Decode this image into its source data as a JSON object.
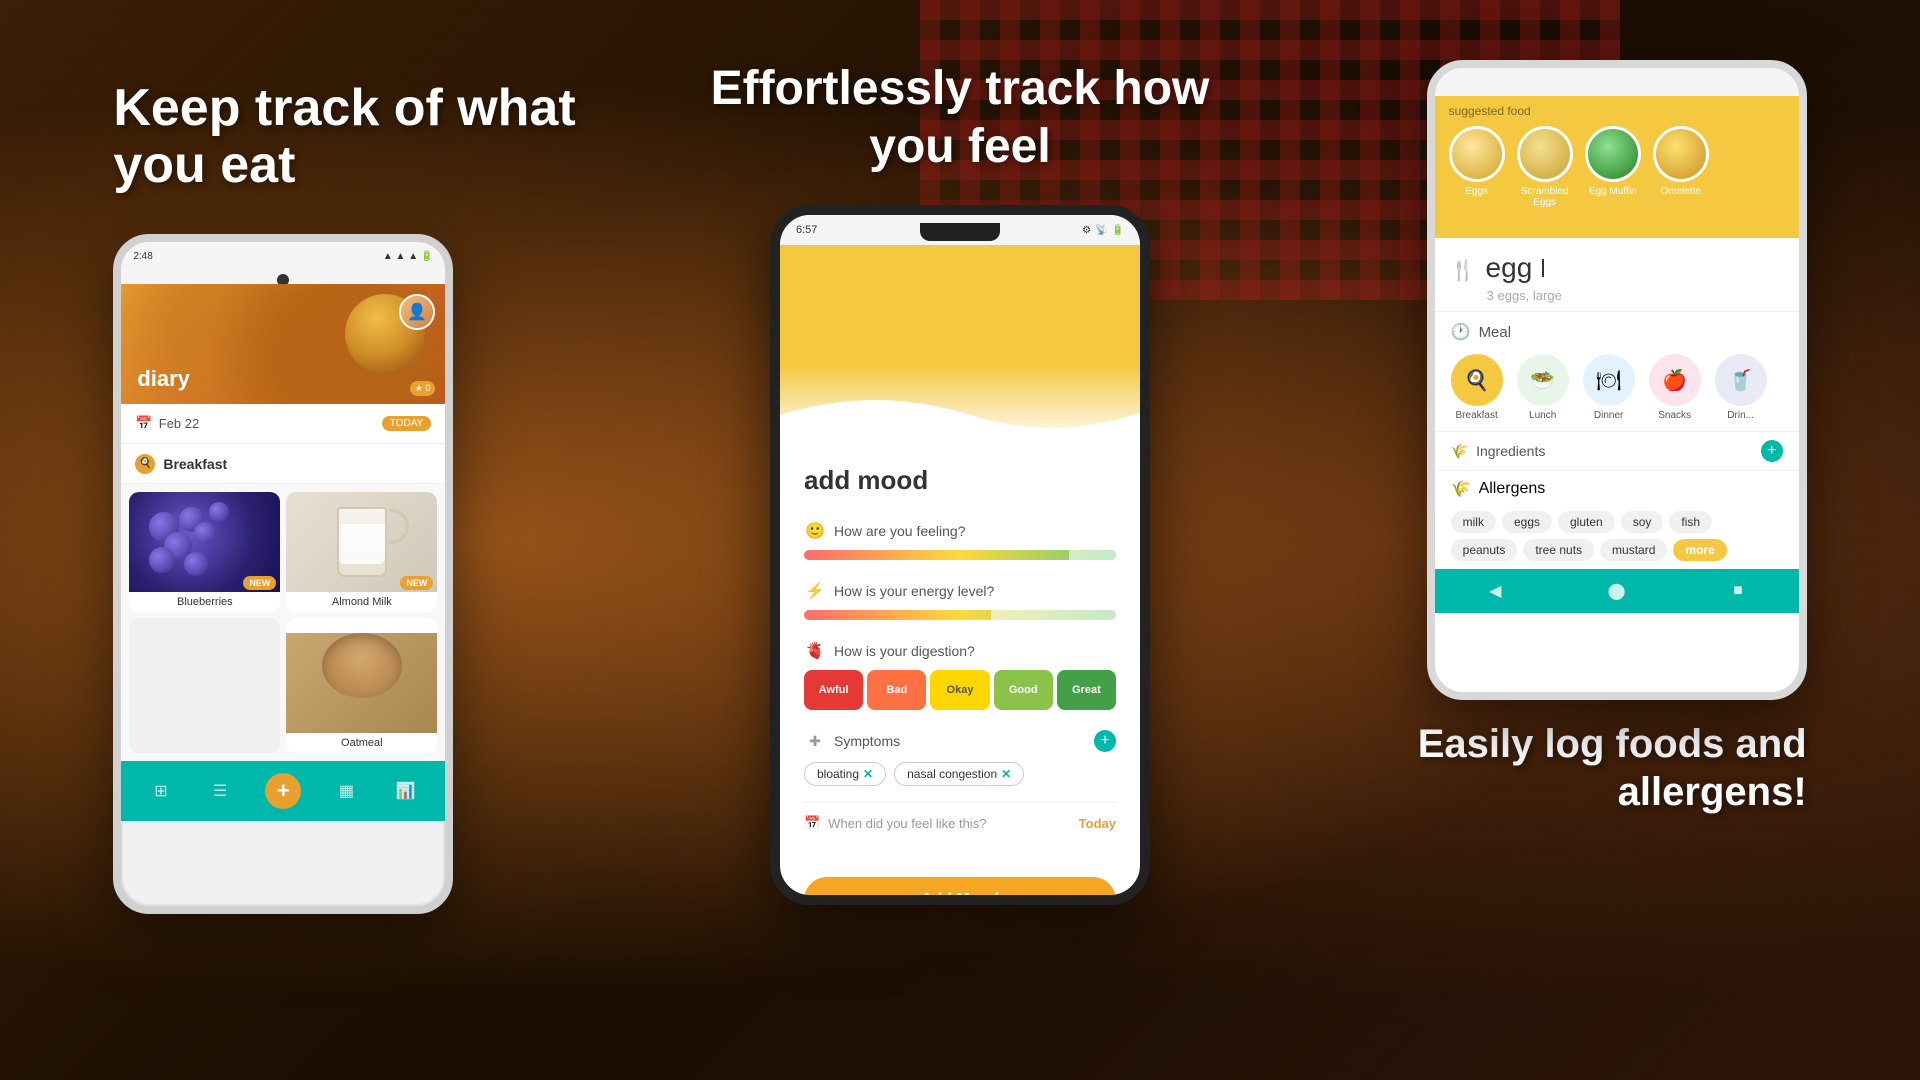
{
  "background": {
    "color": "#2a1a0a"
  },
  "left_panel": {
    "headline": "Keep track of what you eat",
    "phone": {
      "status_bar": {
        "time": "2:48",
        "icons": "📶🔋"
      },
      "diary": {
        "title": "diary",
        "date": "Feb 22",
        "today_label": "TODAY",
        "section": "Breakfast",
        "star_badge": "★ 0"
      },
      "food_items": [
        {
          "name": "Blueberries",
          "badge": "NEW",
          "type": "blueberries"
        },
        {
          "name": "Almond Milk",
          "badge": "NEW",
          "type": "almond_milk"
        },
        {
          "name": "",
          "badge": "",
          "type": "empty"
        },
        {
          "name": "Oatmeal",
          "badge": "",
          "type": "oatmeal"
        }
      ],
      "nav_icons": [
        "grid",
        "bookmark",
        "+",
        "calendar",
        "chart"
      ]
    }
  },
  "center_panel": {
    "headline": "Effortlessly track how you feel",
    "phone": {
      "status_bar": {
        "time": "6:57",
        "icons": "⚙️📶🔋"
      },
      "mood": {
        "title": "add mood",
        "feeling": {
          "question": "How are you feeling?",
          "fill_percent": 85
        },
        "energy": {
          "question": "How is your energy level?",
          "fill_percent": 60
        },
        "digestion": {
          "question": "How is your digestion?",
          "options": [
            "Awful",
            "Bad",
            "Okay",
            "Good",
            "Great"
          ],
          "selected": "Great"
        },
        "symptoms": {
          "title": "Symptoms",
          "tags": [
            "bloating",
            "nasal congestion"
          ]
        },
        "when": {
          "label": "When did you feel like this?",
          "value": "Today"
        },
        "button": "Add Mood"
      }
    }
  },
  "right_panel": {
    "phone": {
      "suggested": {
        "label": "suggested food",
        "foods": [
          {
            "name": "Eggs",
            "type": "eggs"
          },
          {
            "name": "Scrambled\nEggs",
            "type": "scrambled"
          },
          {
            "name": "Egg Muffin",
            "type": "muffin"
          },
          {
            "name": "Omelette",
            "type": "omelette"
          }
        ]
      },
      "search": {
        "food_name": "egg",
        "description": "3 eggs, large"
      },
      "meal": {
        "title": "Meal",
        "options": [
          "Breakfast",
          "Lunch",
          "Dinner",
          "Snacks",
          "Drink"
        ],
        "selected": "Breakfast"
      },
      "ingredients": {
        "title": "Ingredients"
      },
      "allergens": {
        "title": "Allergens",
        "tags": [
          "milk",
          "eggs",
          "gluten",
          "soy",
          "fish",
          "peanuts",
          "tree nuts",
          "mustard"
        ],
        "more": "more"
      }
    },
    "headline": "Easily log foods\nand allergens!"
  }
}
